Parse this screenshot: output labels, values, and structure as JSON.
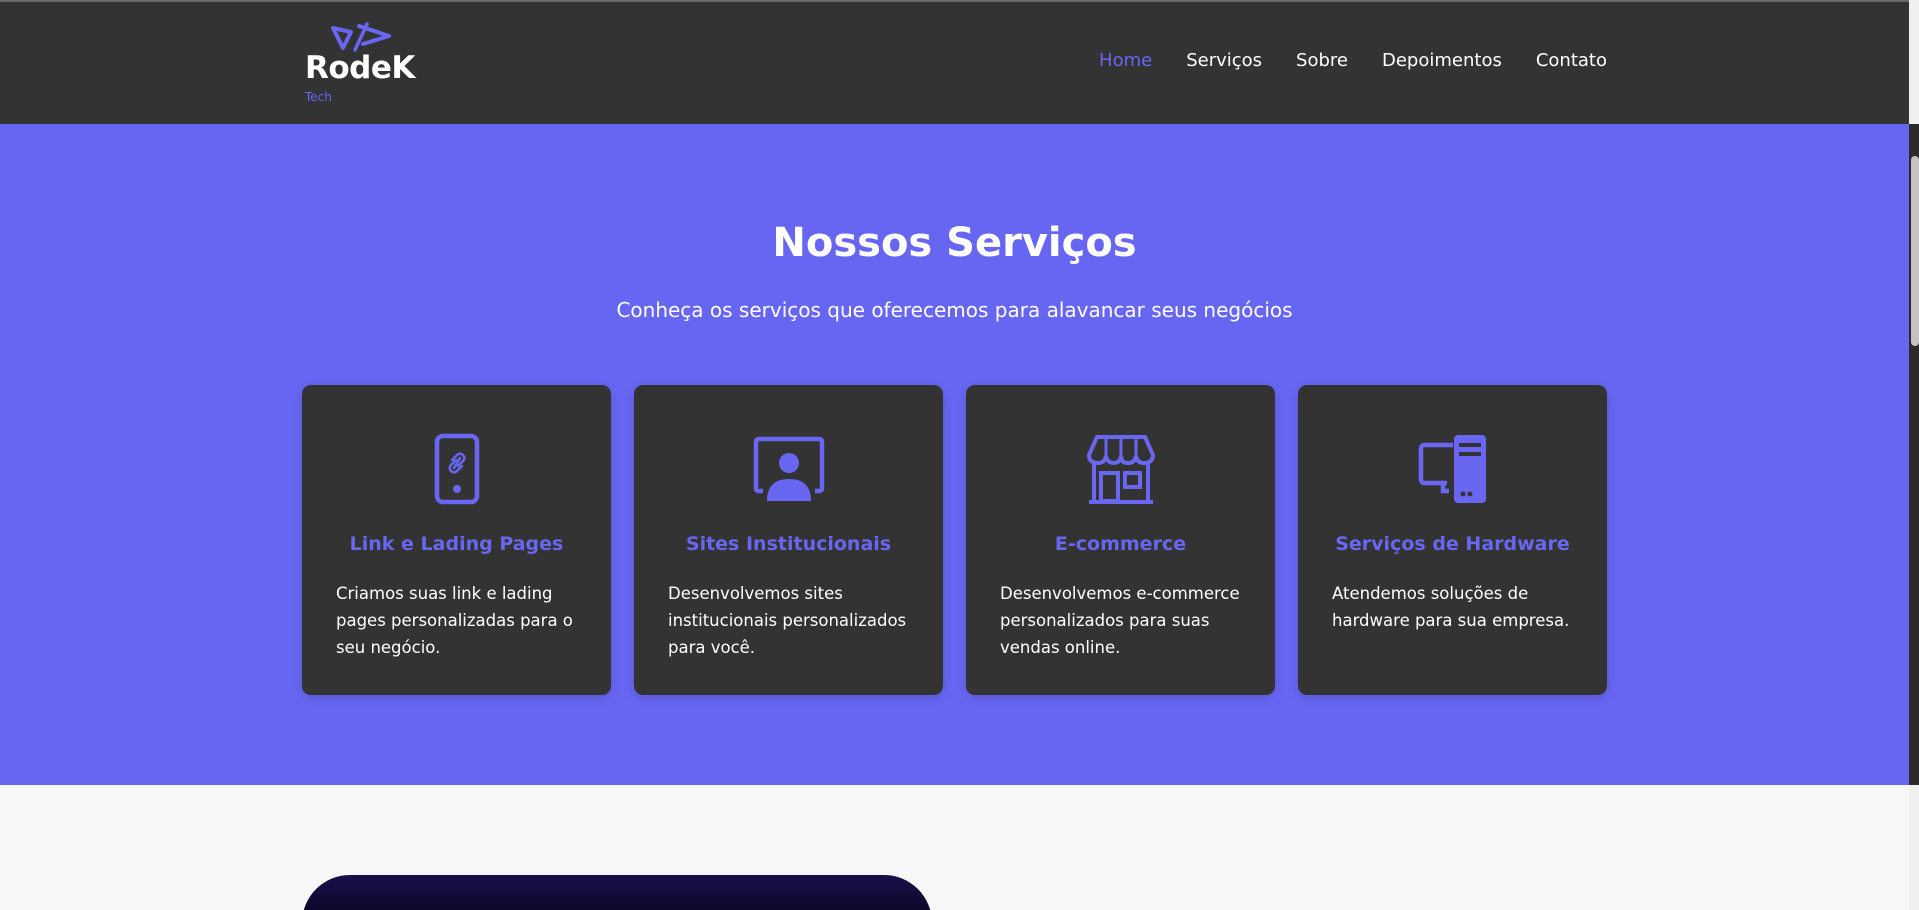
{
  "brand": {
    "name": "RodeK",
    "sub": "Tech",
    "accent": "#6966f2"
  },
  "nav": {
    "items": [
      {
        "label": "Home",
        "active": true
      },
      {
        "label": "Serviços",
        "active": false
      },
      {
        "label": "Sobre",
        "active": false
      },
      {
        "label": "Depoimentos",
        "active": false
      },
      {
        "label": "Contato",
        "active": false
      }
    ]
  },
  "services": {
    "title": "Nossos Serviços",
    "subtitle": "Conheça os serviços que oferecemos para alavancar seus negócios",
    "background": "#6766f3",
    "cards": [
      {
        "icon": "mobile-link-icon",
        "title": "Link e Lading Pages",
        "text": "Criamos suas link e lading pages personalizadas para o seu negócio."
      },
      {
        "icon": "user-screen-icon",
        "title": "Sites Institucionais",
        "text": "Desenvolvemos sites institucionais personalizados para você."
      },
      {
        "icon": "store-icon",
        "title": "E-commerce",
        "text": "Desenvolvemos e-commerce personalizados para suas vendas online."
      },
      {
        "icon": "computer-hardware-icon",
        "title": "Serviços de Hardware",
        "text": "Atendemos soluções de hardware para sua empresa."
      }
    ]
  }
}
